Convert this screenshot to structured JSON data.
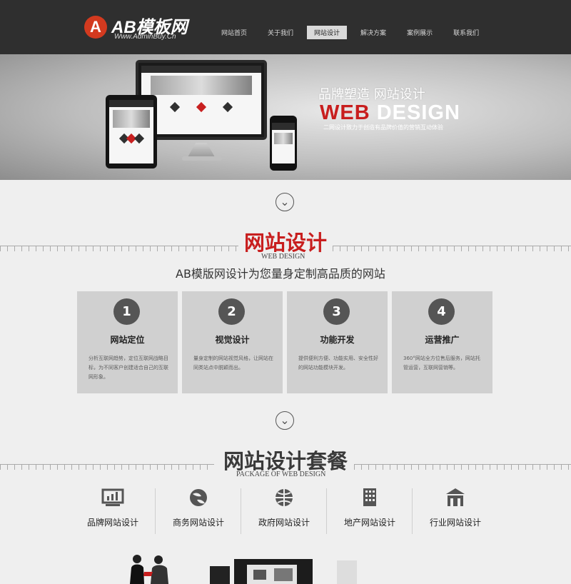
{
  "header": {
    "logo_mark": "A",
    "logo_title": "AB模板网",
    "logo_sub": "Www.AdminBuy.Cn",
    "nav": [
      {
        "label": "网站首页",
        "active": false
      },
      {
        "label": "关于我们",
        "active": false
      },
      {
        "label": "网站设计",
        "active": true
      },
      {
        "label": "解决方案",
        "active": false
      },
      {
        "label": "案例展示",
        "active": false
      },
      {
        "label": "联系我们",
        "active": false
      }
    ]
  },
  "banner": {
    "title_line1": "品牌塑造 网站设计",
    "web": "WEB",
    "design": "DESIGN",
    "subtitle": "二网设计致力于创造有品牌价值的营销互动体验"
  },
  "section1": {
    "title": "网站设计",
    "english": "WEB DESIGN",
    "subtitle": "AB模版网设计为您量身定制高品质的网站",
    "cards": [
      {
        "number": "1",
        "title": "网站定位",
        "desc": "分析互联网趋势，定位互联网战略目标，为不同客户创建适合自己的互联网形象。"
      },
      {
        "number": "2",
        "title": "视觉设计",
        "desc": "量身定制的网站视觉风格，让网站在同类站点中脱颖而出。"
      },
      {
        "number": "3",
        "title": "功能开发",
        "desc": "提供便利方便、功能实用、安全性好的网站功能模块开发。"
      },
      {
        "number": "4",
        "title": "运营推广",
        "desc": "360°网站全方位售后服务，网站托管运营，互联网营销等。"
      }
    ]
  },
  "section2": {
    "title": "网站设计套餐",
    "english": "PACKAGE OF WEB DESIGN",
    "packages": [
      {
        "label": "品牌网站设计",
        "icon": "chart-icon"
      },
      {
        "label": "商务网站设计",
        "icon": "globe-icon"
      },
      {
        "label": "政府网站设计",
        "icon": "world-icon"
      },
      {
        "label": "地产网站设计",
        "icon": "building-icon"
      },
      {
        "label": "行业网站设计",
        "icon": "industry-icon"
      }
    ]
  },
  "colors": {
    "accent": "#c81e1e",
    "header": "#2f2f2f",
    "card": "#d0d0d0"
  }
}
